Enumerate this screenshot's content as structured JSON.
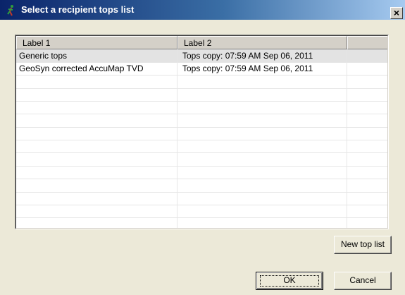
{
  "window": {
    "title": "Select a recipient tops list",
    "close_label": "×",
    "app_icon": "geoscience-app-icon"
  },
  "list": {
    "columns": [
      "Label 1",
      "Label 2",
      ""
    ],
    "rows": [
      {
        "label1": "Generic tops",
        "label2": "Tops copy: 07:59 AM Sep 06, 2011",
        "selected": true
      },
      {
        "label1": "GeoSyn corrected AccuMap TVD",
        "label2": "Tops copy: 07:59 AM Sep 06, 2011",
        "selected": false
      }
    ],
    "selection_color": "#E3E3E3"
  },
  "buttons": {
    "new_top_list": "New top list",
    "ok": "OK",
    "cancel": "Cancel"
  }
}
